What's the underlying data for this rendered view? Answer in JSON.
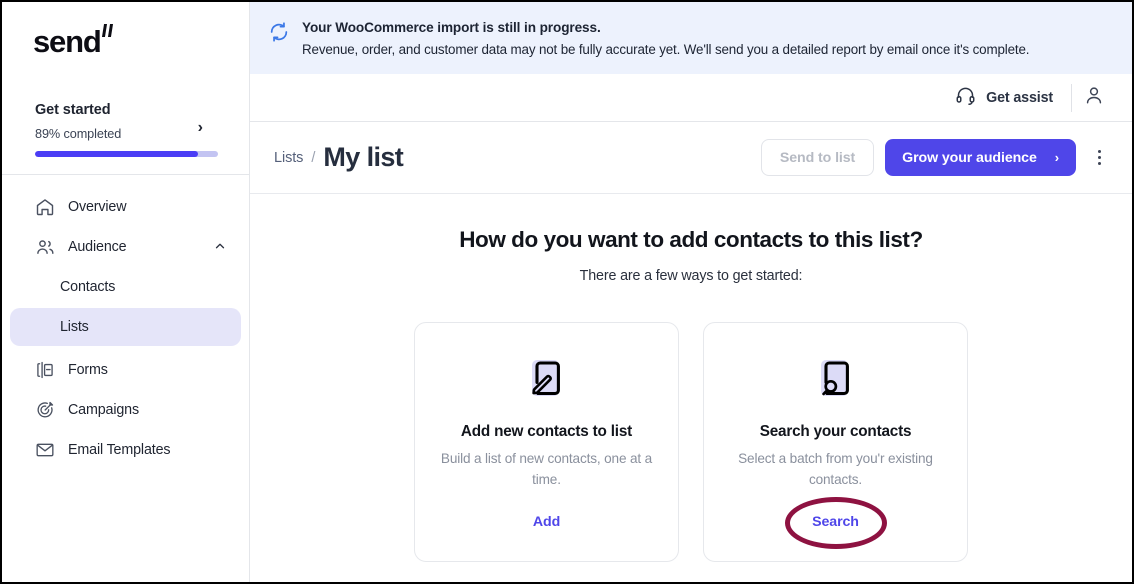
{
  "sidebar": {
    "logo_text": "send",
    "get_started": {
      "title": "Get started",
      "progress_label": "89% completed",
      "progress_percent": 89,
      "chevron_icon": "chevron-right-icon"
    },
    "nav": [
      {
        "label": "Overview",
        "icon": "home-icon"
      },
      {
        "label": "Audience",
        "icon": "users-icon",
        "caret": "chevron-up-icon",
        "expanded": true
      },
      {
        "label": "Contacts",
        "sub": true,
        "active": false
      },
      {
        "label": "Lists",
        "sub": true,
        "active": true
      },
      {
        "label": "Forms",
        "icon": "form-icon"
      },
      {
        "label": "Campaigns",
        "icon": "target-icon"
      },
      {
        "label": "Email Templates",
        "icon": "envelope-icon"
      }
    ]
  },
  "banner": {
    "icon": "sync-refresh-icon",
    "title": "Your WooCommerce import is still in progress.",
    "description": "Revenue, order, and customer data may not be fully accurate yet. We'll send you a detailed report by email once it's complete.",
    "background_color": "#edf2fd"
  },
  "topbar": {
    "assist_label": "Get assist",
    "assist_icon": "headset-icon",
    "avatar_icon": "user-avatar-icon"
  },
  "page_header": {
    "breadcrumb_parent": "Lists",
    "breadcrumb_separator": "/",
    "title": "My list",
    "send_to_list_label": "Send to list",
    "grow_audience_label": "Grow your audience",
    "grow_audience_chevron": "›",
    "more_menu_icon": "kebab-menu-icon",
    "primary_color": "#4f46e9"
  },
  "content": {
    "heading": "How do you want to add contacts to this list?",
    "subheading": "There are a few ways to get started:",
    "cards": [
      {
        "icon": "document-pencil-icon",
        "title": "Add new contacts to list",
        "description": "Build a list of new contacts, one at a time.",
        "link_label": "Add",
        "annotated": false
      },
      {
        "icon": "document-search-icon",
        "title": "Search your contacts",
        "description": "Select a batch from you'r existing contacts.",
        "link_label": "Search",
        "annotated": true,
        "annotation_color": "#8e1241"
      }
    ]
  }
}
